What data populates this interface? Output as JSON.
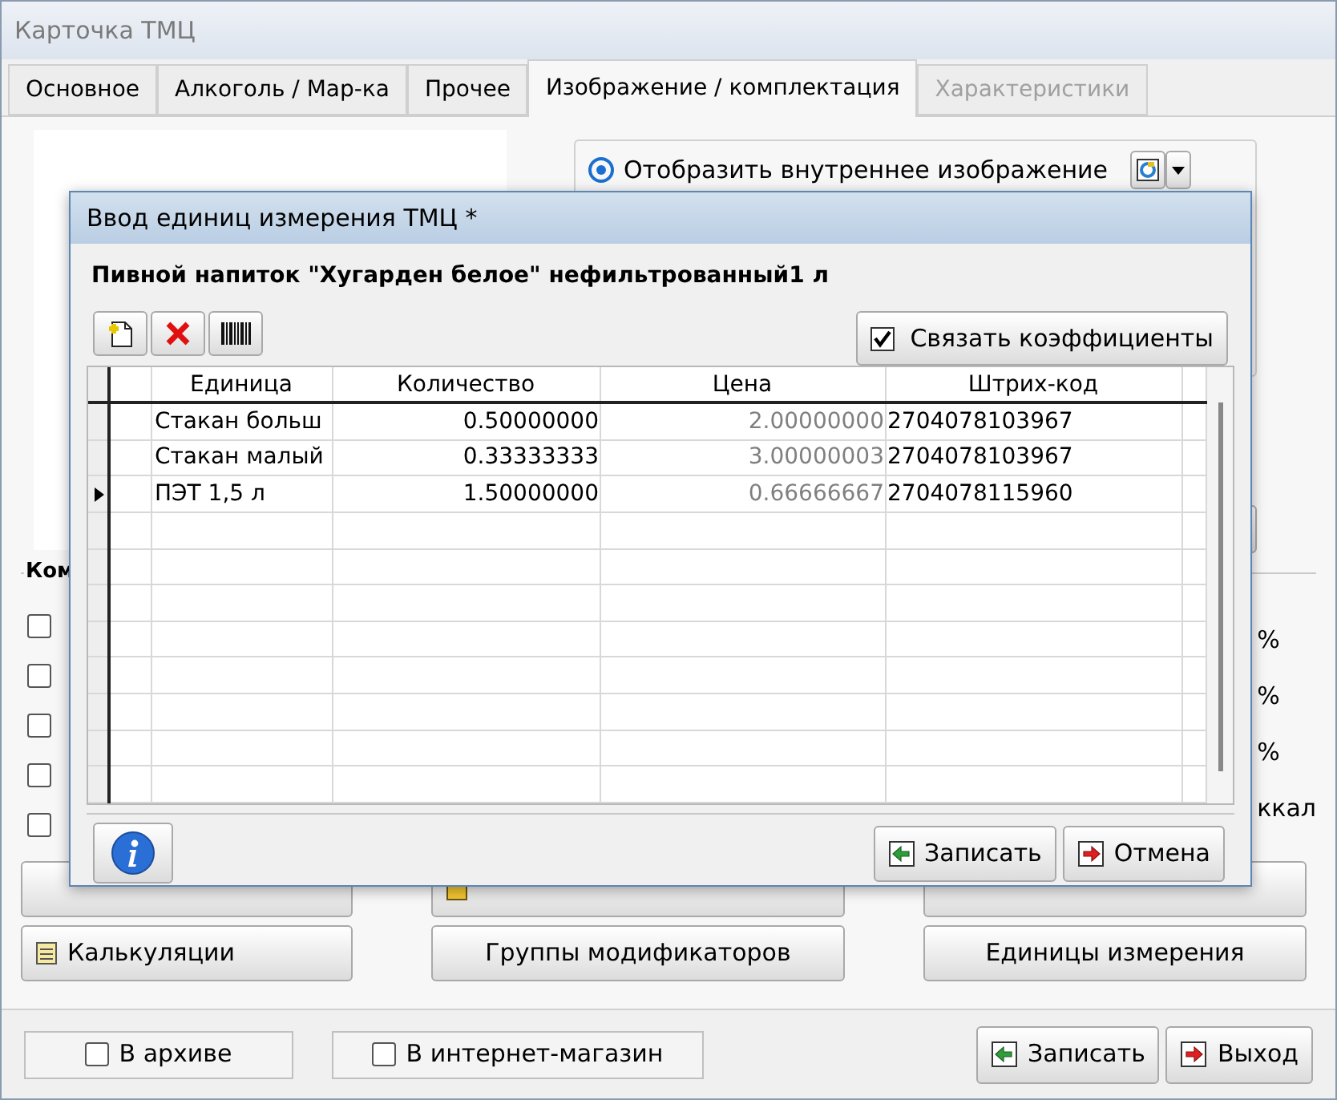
{
  "window": {
    "title": "Карточка ТМЦ"
  },
  "tabs": [
    {
      "label": "Основное",
      "selected": false,
      "disabled": false
    },
    {
      "label": "Алкоголь / Мар-ка",
      "selected": false,
      "disabled": false
    },
    {
      "label": "Прочее",
      "selected": false,
      "disabled": false
    },
    {
      "label": "Изображение / комплектация",
      "selected": true,
      "disabled": false
    },
    {
      "label": "Характеристики",
      "selected": false,
      "disabled": true
    }
  ],
  "image_source": {
    "label": "Отобразить внутреннее изображение",
    "selected": true
  },
  "composition_group": {
    "title": "Ком",
    "options": [
      {
        "checked": false
      },
      {
        "checked": false
      },
      {
        "checked": false
      },
      {
        "checked": false
      },
      {
        "checked": false
      }
    ],
    "units": [
      "%",
      "%",
      "%",
      "ккал"
    ]
  },
  "action_buttons": [
    {
      "label": "Калькуляции"
    },
    {
      "label": "Группы модификаторов"
    },
    {
      "label": "Единицы измерения"
    }
  ],
  "footer": {
    "flags": [
      {
        "label": "В архиве",
        "checked": false
      },
      {
        "label": "В интернет-магазин",
        "checked": false
      }
    ],
    "buttons": [
      {
        "label": "Записать",
        "kind": "save"
      },
      {
        "label": "Выход",
        "kind": "exit"
      }
    ]
  },
  "dialog": {
    "title": "Ввод единиц измерения ТМЦ *",
    "item_name": "Пивной напиток \"Хугарден белое\" нефильтрованный1 л",
    "link_coefficients": {
      "label": "Связать коэффициенты",
      "checked": true
    },
    "table": {
      "columns": [
        "Единица",
        "Количество",
        "Цена",
        "Штрих-код"
      ],
      "rows": [
        {
          "cells": [
            "Стакан больш",
            "0.50000000",
            "2.00000000",
            "2704078103967"
          ],
          "selected": false
        },
        {
          "cells": [
            "Стакан малый",
            "0.33333333",
            "3.00000003",
            "2704078103967"
          ],
          "selected": false
        },
        {
          "cells": [
            "ПЭТ 1,5 л",
            "1.50000000",
            "0.66666667",
            "2704078115960"
          ],
          "selected": true
        }
      ]
    },
    "buttons": [
      {
        "label": "Записать",
        "kind": "save"
      },
      {
        "label": "Отмена",
        "kind": "exit"
      }
    ]
  }
}
